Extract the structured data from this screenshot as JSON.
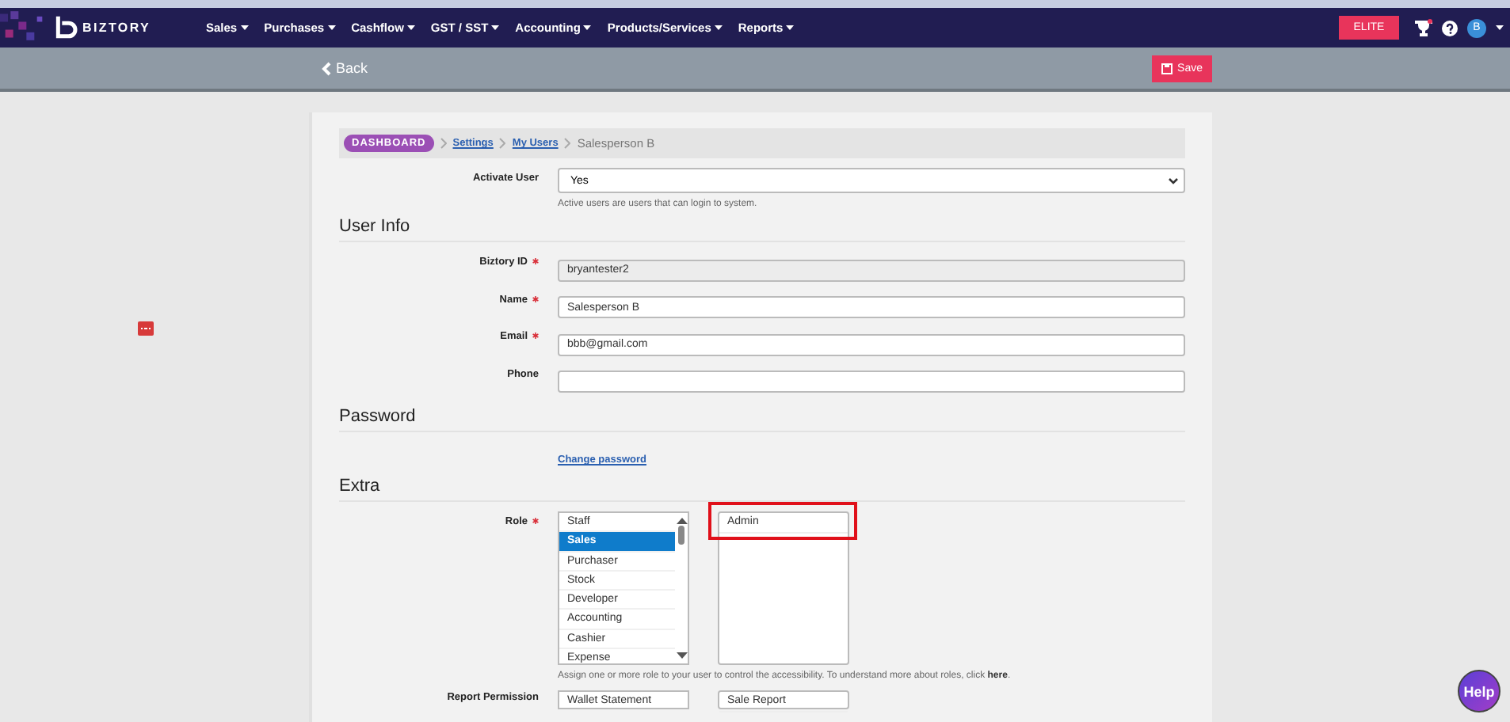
{
  "nav": {
    "logo": "BIZTORY",
    "menus": [
      "Sales",
      "Purchases",
      "Cashflow",
      "GST / SST",
      "Accounting",
      "Products/Services",
      "Reports"
    ],
    "plan": "ELITE",
    "avatar": "B"
  },
  "subheader": {
    "back": "Back",
    "save": "Save"
  },
  "breadcrumb": [
    {
      "label": "DASHBOARD",
      "kind": "badge"
    },
    {
      "label": "Settings",
      "kind": "link"
    },
    {
      "label": "My Users",
      "kind": "link"
    },
    {
      "label": "Salesperson B",
      "kind": "current"
    }
  ],
  "activate_user": {
    "label": "Activate User",
    "value": "Yes",
    "hint": "Active users are users that can login to system."
  },
  "user_info": {
    "heading": "User Info",
    "fields": [
      {
        "label": "Biztory ID",
        "required": true,
        "value": "bryantester2",
        "disabled": true
      },
      {
        "label": "Name",
        "required": true,
        "value": "Salesperson B",
        "disabled": false
      },
      {
        "label": "Email",
        "required": true,
        "value": "bbb@gmail.com",
        "disabled": false
      },
      {
        "label": "Phone",
        "required": false,
        "disabled": false
      }
    ]
  },
  "password": {
    "heading": "Password",
    "link": "Change password"
  },
  "extra": {
    "heading": "Extra",
    "role": {
      "label": "Role",
      "required": true,
      "options": [
        {
          "label": "Staff",
          "selected": false
        },
        {
          "label": "Sales",
          "selected": true
        },
        {
          "label": "Purchaser",
          "selected": false
        },
        {
          "label": "Stock",
          "selected": false
        },
        {
          "label": "Developer",
          "selected": false
        },
        {
          "label": "Accounting",
          "selected": false
        },
        {
          "label": "Cashier",
          "selected": false
        },
        {
          "label": "Expense",
          "selected": false
        }
      ],
      "assigned": [
        "Admin"
      ],
      "hint": "Assign one or more role to your user to control the accessibility. To understand more about roles, click ",
      "hint_link": "here",
      "hint_end": "."
    },
    "report_permission": {
      "label": "Report Permission",
      "options": [
        "Wallet Statement"
      ],
      "assigned": [
        "Sale Report"
      ]
    }
  },
  "help": "Help"
}
